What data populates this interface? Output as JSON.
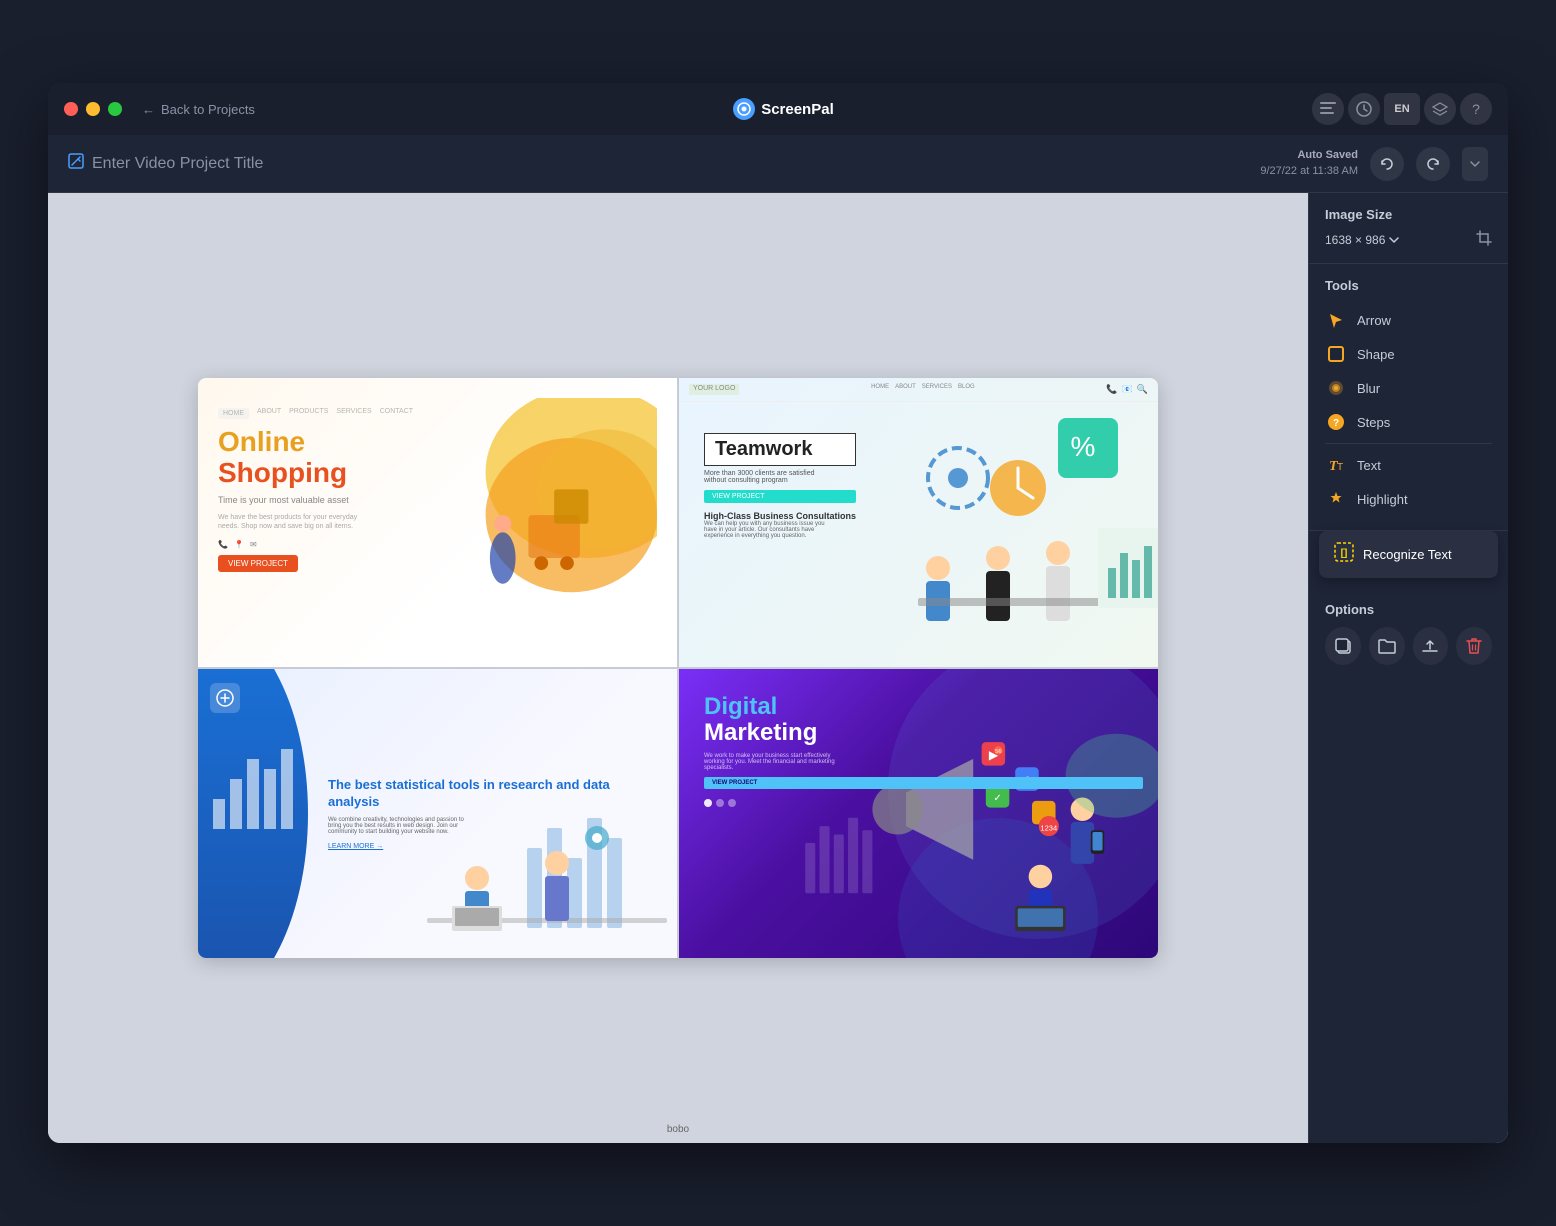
{
  "window": {
    "title": "ScreenPal"
  },
  "titlebar": {
    "back_label": "Back to Projects",
    "logo_text": "ScreenPal",
    "en_label": "EN",
    "undo_label": "↩",
    "redo_label": "↪"
  },
  "project_bar": {
    "title_placeholder": "Enter Video Project Title",
    "auto_saved_label": "Auto Saved",
    "auto_saved_date": "9/27/22 at 11:38 AM"
  },
  "right_panel": {
    "image_size_label": "Image Size",
    "image_size_value": "1638 × 986",
    "tools_label": "Tools",
    "tools": [
      {
        "name": "arrow",
        "label": "Arrow",
        "icon": "→",
        "color": "#f5a623"
      },
      {
        "name": "shape",
        "label": "Shape",
        "icon": "□",
        "color": "#f5a623"
      },
      {
        "name": "blur",
        "label": "Blur",
        "icon": "◉",
        "color": "#f5a623"
      },
      {
        "name": "steps",
        "label": "Steps",
        "icon": "❓",
        "color": "#f5a623"
      },
      {
        "name": "text",
        "label": "Text",
        "icon": "T",
        "color": "#f5a623"
      },
      {
        "name": "highlight",
        "label": "Highlight",
        "icon": "✦",
        "color": "#f5a623"
      }
    ],
    "recognize_text_label": "Recognize Text",
    "options_label": "Options",
    "options_icons": [
      {
        "name": "copy",
        "icon": "⬜",
        "label": "copy"
      },
      {
        "name": "folder",
        "icon": "📁",
        "label": "folder"
      },
      {
        "name": "upload",
        "icon": "⬆",
        "label": "upload"
      },
      {
        "name": "delete",
        "icon": "🗑",
        "label": "delete"
      }
    ]
  },
  "canvas": {
    "cells": [
      {
        "id": "shopping",
        "title_line1": "Online",
        "title_line2": "Shopping",
        "subtitle": "Time is your most valuable asset"
      },
      {
        "id": "teamwork",
        "badge": "Teamwork",
        "subtitle": "More than 3000 clients are satisfied without consulting program",
        "cta": "VIEW PROJECT",
        "desc_title": "High-Class Business Consultations",
        "desc": "We can help you with any business issue you have in your article. Our consultants have experience in everything you question."
      },
      {
        "id": "stats",
        "title": "The best statistical tools in research and data analysis",
        "desc": "We combine creativity, technologies and passion to bring you the best results in web design. Join our community to start building your website now.",
        "link": "LEARN MORE →"
      },
      {
        "id": "digital",
        "title_line1": "Digital",
        "title_line2": "Marketing",
        "desc": "We work to make your business start effectively working for you. Meet the financial and marketing specialists.",
        "cta": "VIEW PROJECT"
      }
    ]
  }
}
